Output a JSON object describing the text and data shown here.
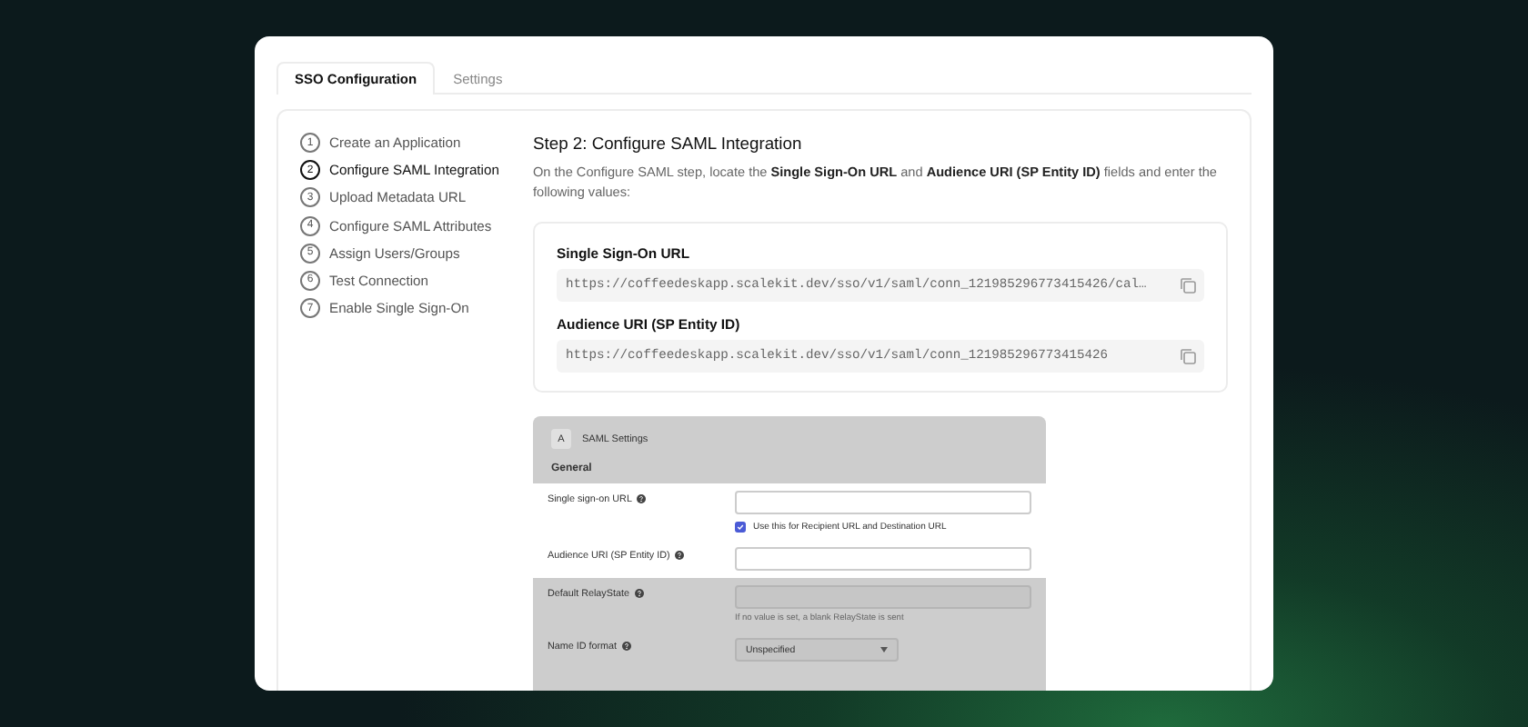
{
  "tabs": [
    {
      "label": "SSO Configuration",
      "selected": true
    },
    {
      "label": "Settings",
      "selected": false
    }
  ],
  "steps": [
    {
      "number": "1",
      "label": "Create an Application",
      "selected": false
    },
    {
      "number": "2",
      "label": "Configure SAML Integration",
      "selected": true
    },
    {
      "number": "3",
      "label": "Upload Metadata URL",
      "selected": false
    },
    {
      "number": "4",
      "label": "Configure SAML Attributes",
      "selected": false
    },
    {
      "number": "5",
      "label": "Assign Users/Groups",
      "selected": false
    },
    {
      "number": "6",
      "label": "Test Connection",
      "selected": false
    },
    {
      "number": "7",
      "label": "Enable Single Sign-On",
      "selected": false
    }
  ],
  "step_title": "Step 2: Configure SAML Integration",
  "description": "On the Configure SAML step, locate the **Single Sign-On URL** and **Audience URI (SP Entity ID)** fields and enter the following values:",
  "fields": [
    {
      "label": "Single Sign-On URL",
      "value": "https://coffeedeskapp.scalekit.dev/sso/v1/saml/conn_121985296773415426/cal…"
    },
    {
      "label": "Audience URI (SP Entity ID)",
      "value": "https://coffeedeskapp.scalekit.dev/sso/v1/saml/conn_121985296773415426"
    }
  ],
  "screenshot": {
    "badge": "A",
    "title": "SAML Settings",
    "section": "General",
    "rows": [
      {
        "label": "Single sign-on URL",
        "highlighted": true,
        "kind": "input",
        "checkbox": {
          "label": "Use this for Recipient URL and Destination URL",
          "checked": true
        }
      },
      {
        "label": "Audience URI (SP Entity ID)",
        "highlighted": true,
        "kind": "input"
      },
      {
        "label": "Default RelayState",
        "highlighted": false,
        "kind": "input",
        "hint": "If no value is set, a blank RelayState is sent"
      },
      {
        "label": "Name ID format",
        "highlighted": false,
        "kind": "select",
        "value": "Unspecified"
      }
    ]
  }
}
